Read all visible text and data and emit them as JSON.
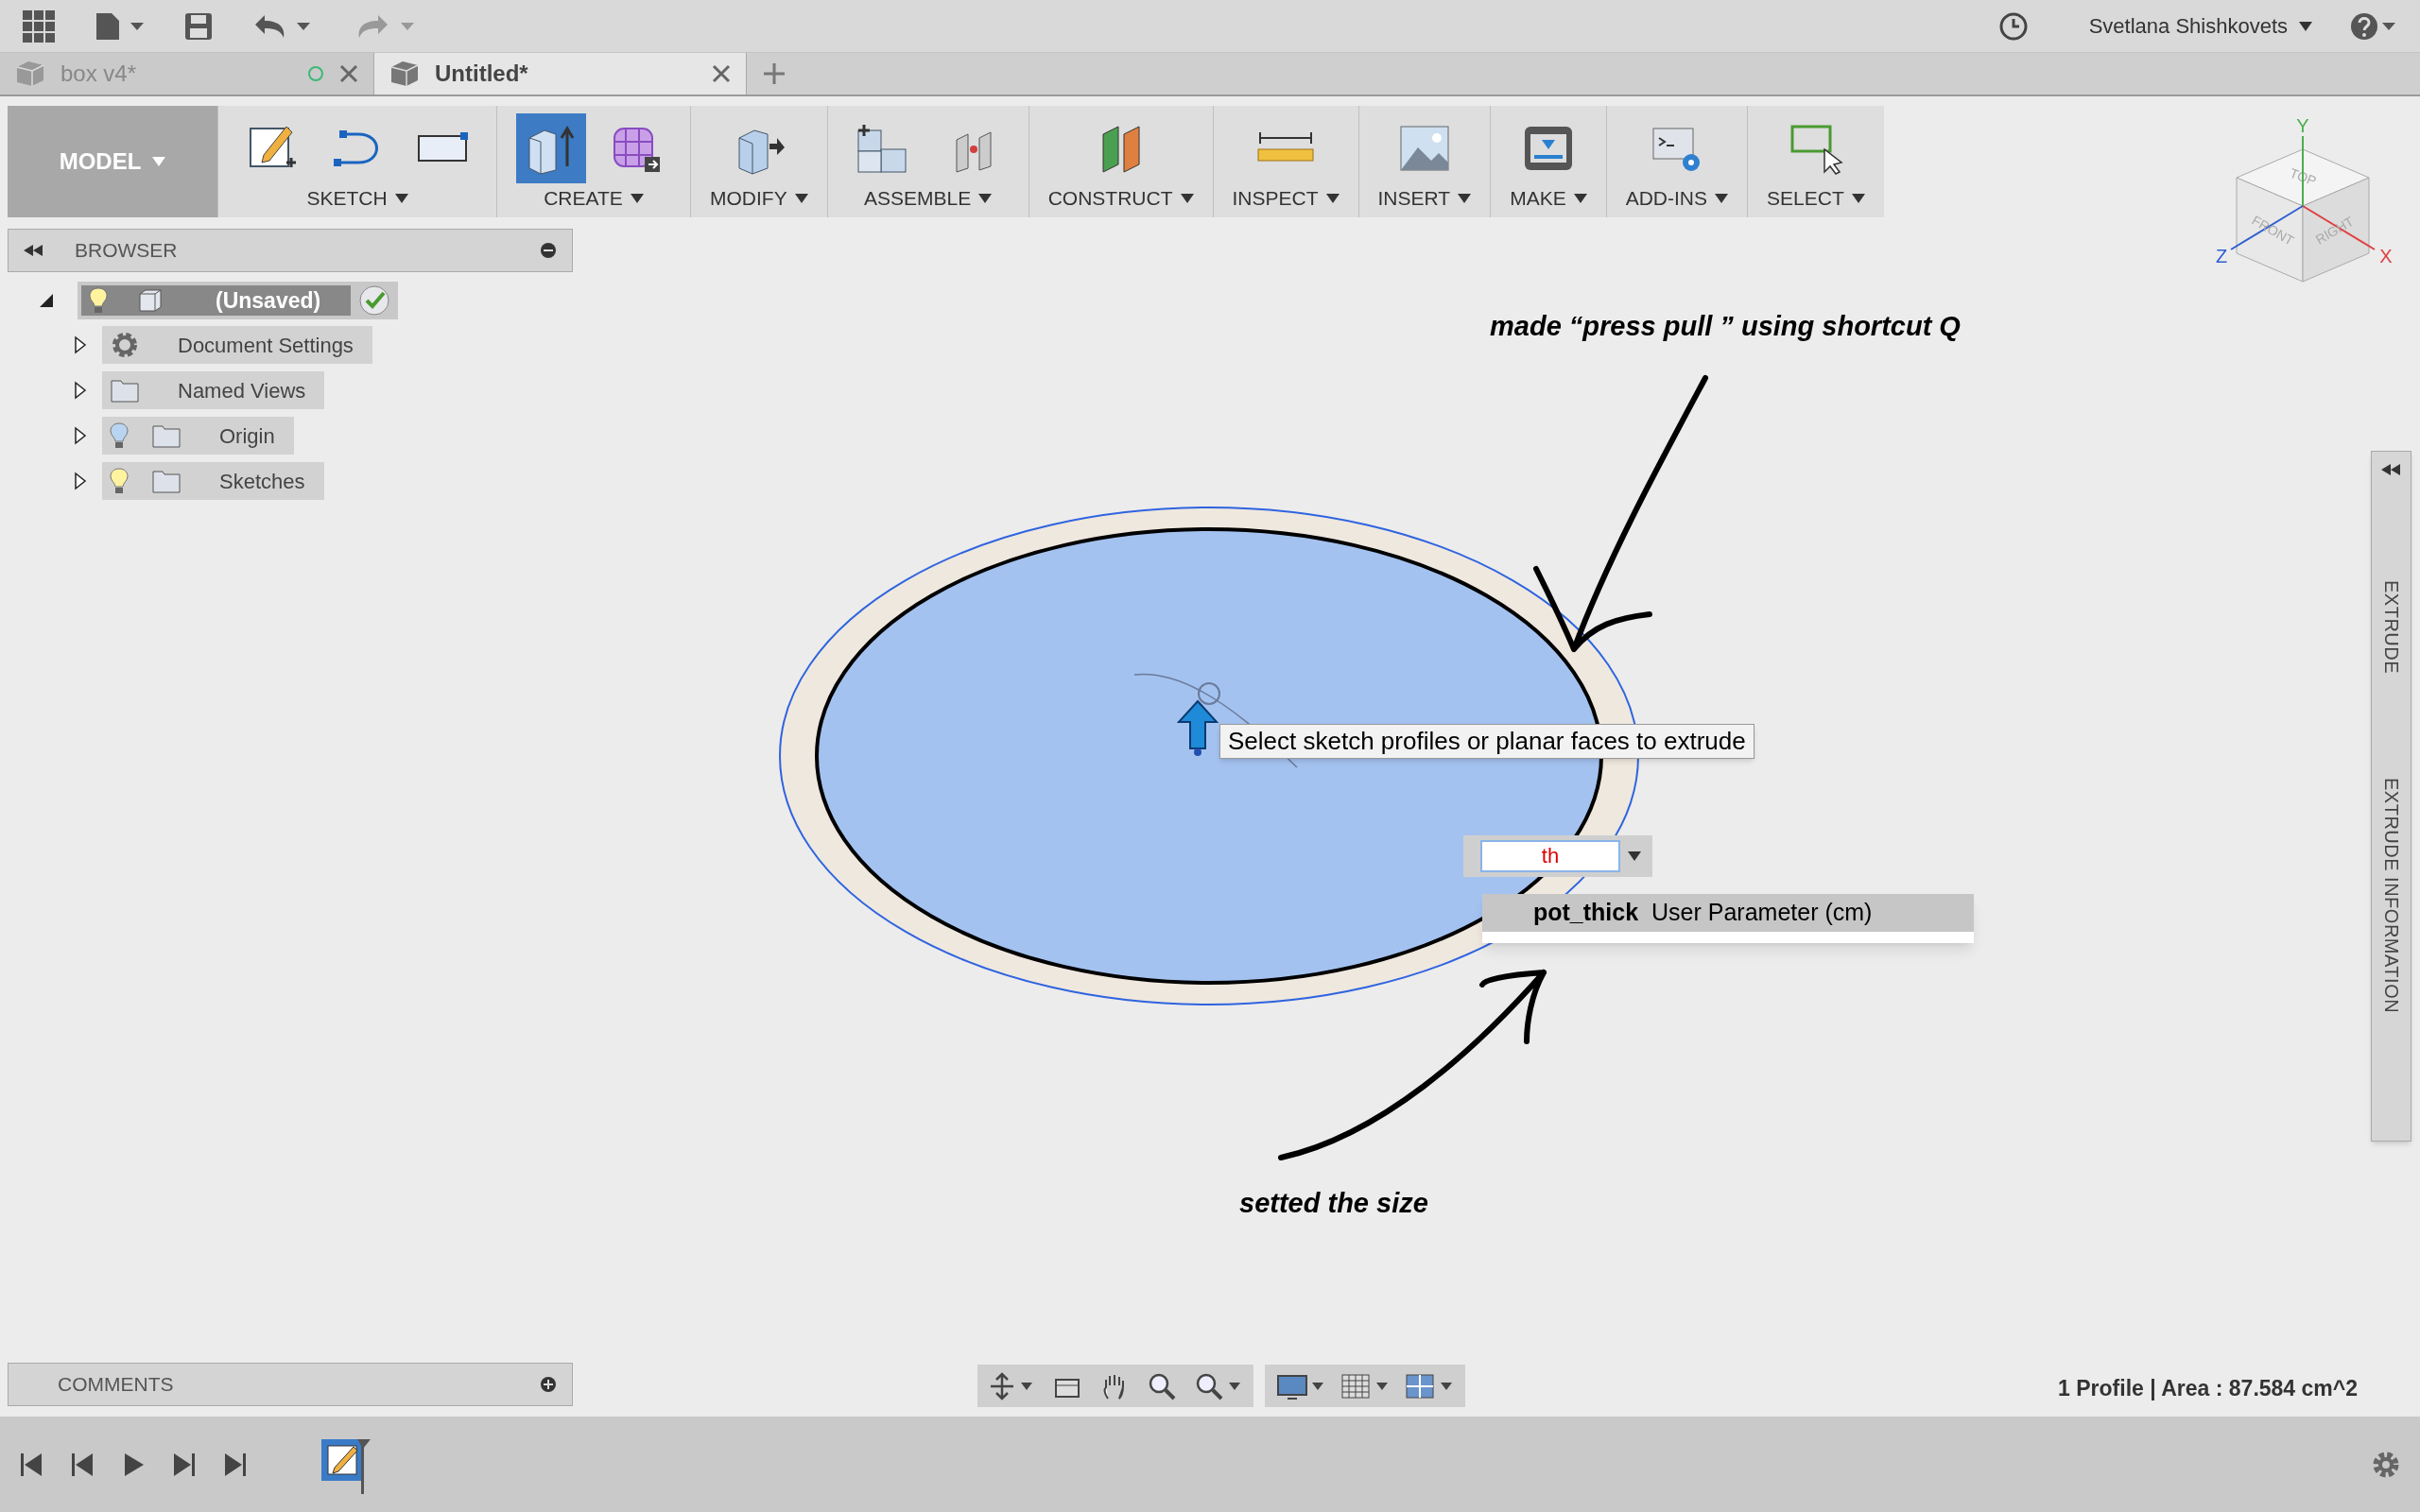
{
  "top_bar": {
    "user_name": "Svetlana Shishkovets"
  },
  "document_tabs": [
    {
      "label": "box v4*",
      "selected": false
    },
    {
      "label": "Untitled*",
      "selected": true
    }
  ],
  "toolbar": {
    "workspace": "MODEL",
    "groups": [
      {
        "label": "SKETCH",
        "tools": [
          {
            "kind": "sketch",
            "active": false
          },
          {
            "kind": "spline",
            "active": false
          },
          {
            "kind": "rectangle",
            "active": false
          }
        ]
      },
      {
        "label": "CREATE",
        "tools": [
          {
            "kind": "presspull",
            "active": true
          },
          {
            "kind": "form",
            "active": false
          }
        ]
      },
      {
        "label": "MODIFY",
        "tools": [
          {
            "kind": "modify",
            "active": false
          }
        ]
      },
      {
        "label": "ASSEMBLE",
        "tools": [
          {
            "kind": "component",
            "active": false
          },
          {
            "kind": "joint",
            "active": false
          }
        ]
      },
      {
        "label": "CONSTRUCT",
        "tools": [
          {
            "kind": "plane",
            "active": false
          }
        ]
      },
      {
        "label": "INSPECT",
        "tools": [
          {
            "kind": "measure",
            "active": false
          }
        ]
      },
      {
        "label": "INSERT",
        "tools": [
          {
            "kind": "image",
            "active": false
          }
        ]
      },
      {
        "label": "MAKE",
        "tools": [
          {
            "kind": "printer",
            "active": false
          }
        ]
      },
      {
        "label": "ADD-INS",
        "tools": [
          {
            "kind": "script",
            "active": false
          }
        ]
      },
      {
        "label": "SELECT",
        "tools": [
          {
            "kind": "select",
            "active": false
          }
        ]
      }
    ]
  },
  "view_cube": {
    "faces": [
      "TOP",
      "FRONT",
      "RIGHT"
    ],
    "axes": [
      "X",
      "Y",
      "Z"
    ]
  },
  "browser": {
    "title": "BROWSER",
    "root": {
      "label": "(Unsaved)",
      "expanded": true,
      "visible": true,
      "children": [
        {
          "label": "Document Settings",
          "kind": "settings",
          "expanded": false
        },
        {
          "label": "Named Views",
          "kind": "folder",
          "expanded": false
        },
        {
          "label": "Origin",
          "kind": "folder",
          "expanded": false,
          "visible": false
        },
        {
          "label": "Sketches",
          "kind": "folder",
          "expanded": false,
          "visible": true
        }
      ]
    }
  },
  "canvas": {
    "tooltip": "Select sketch profiles or planar faces to extrude",
    "distance_input": {
      "value": "th"
    },
    "suggestions": [
      {
        "text": "**pot_thick**  User Parameter (cm)",
        "selected": true
      }
    ]
  },
  "annotations": [
    "made “press pull ” using shortcut Q",
    "setted the size"
  ],
  "side_panel": [
    "EXTRUDE",
    "EXTRUDE INFORMATION"
  ],
  "comments": {
    "title": "COMMENTS"
  },
  "status": "1 Profile | Area : 87.584 cm^2"
}
